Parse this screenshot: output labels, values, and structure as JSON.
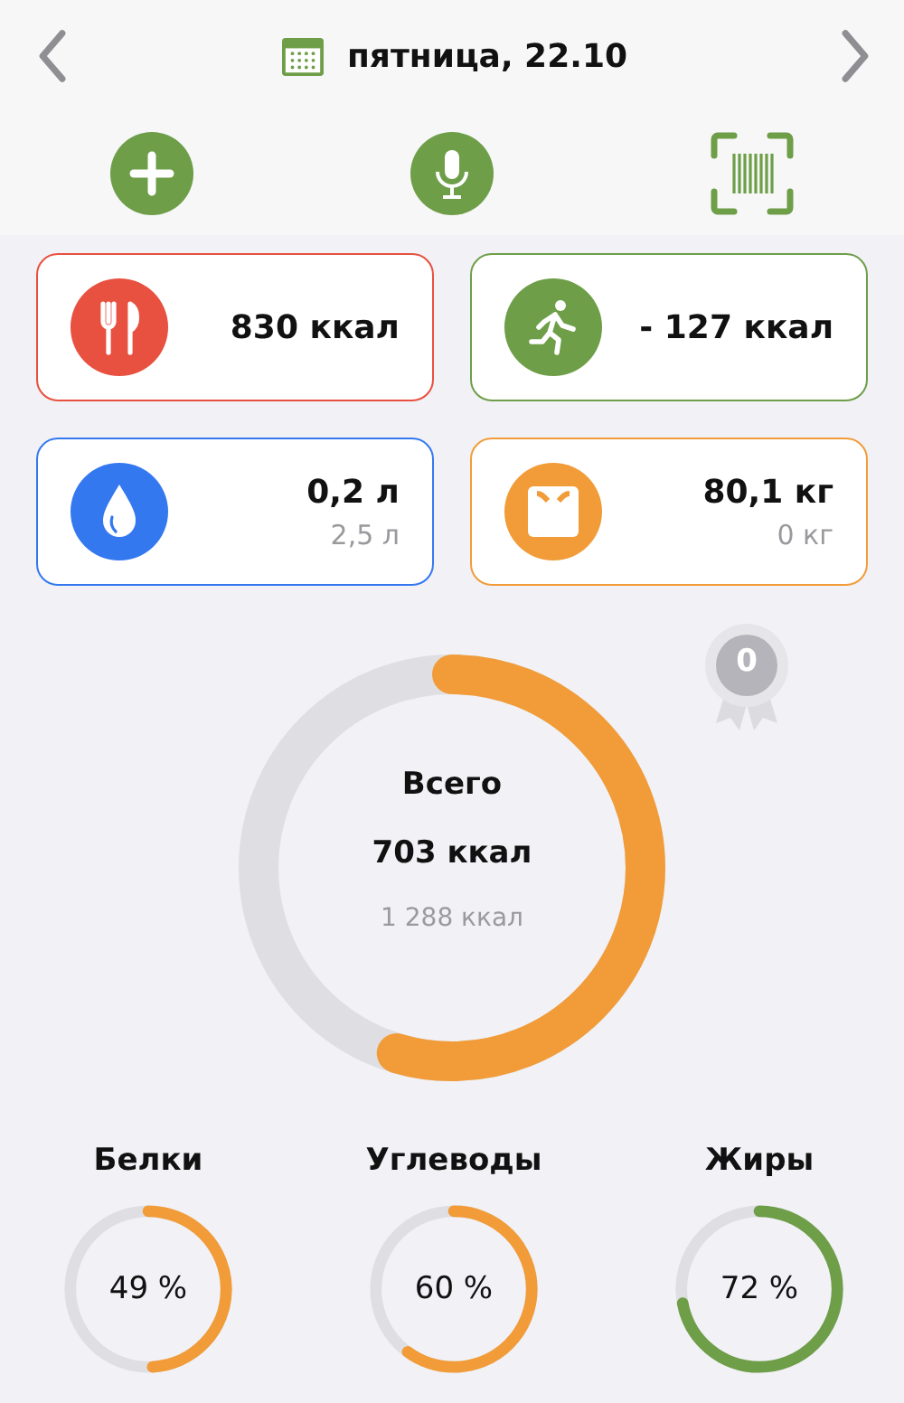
{
  "header": {
    "date": "пятница, 22.10"
  },
  "actions": [
    {
      "kind": "add"
    },
    {
      "kind": "voice"
    },
    {
      "kind": "barcode"
    }
  ],
  "cards": [
    {
      "kind": "food",
      "color": "#e8503f",
      "value": "830 ккал"
    },
    {
      "kind": "activity",
      "color": "#6e9e48",
      "value": "- 127 ккал"
    },
    {
      "kind": "water",
      "color": "#3478f0",
      "value": "0,2 л",
      "secondary": "2,5 л"
    },
    {
      "kind": "weight",
      "color": "#f19c38",
      "value": "80,1 кг",
      "secondary": "0 кг"
    }
  ],
  "total": {
    "title": "Всего",
    "value": "703 ккал",
    "goal": "1 288 ккал"
  },
  "badge": {
    "count": "0"
  },
  "macros": [
    {
      "name": "Белки",
      "percent": "49 %",
      "color": "#f19c38"
    },
    {
      "name": "Углеводы",
      "percent": "60 %",
      "color": "#f19c38"
    },
    {
      "name": "Жиры",
      "percent": "72 %",
      "color": "#6e9e48"
    }
  ]
}
